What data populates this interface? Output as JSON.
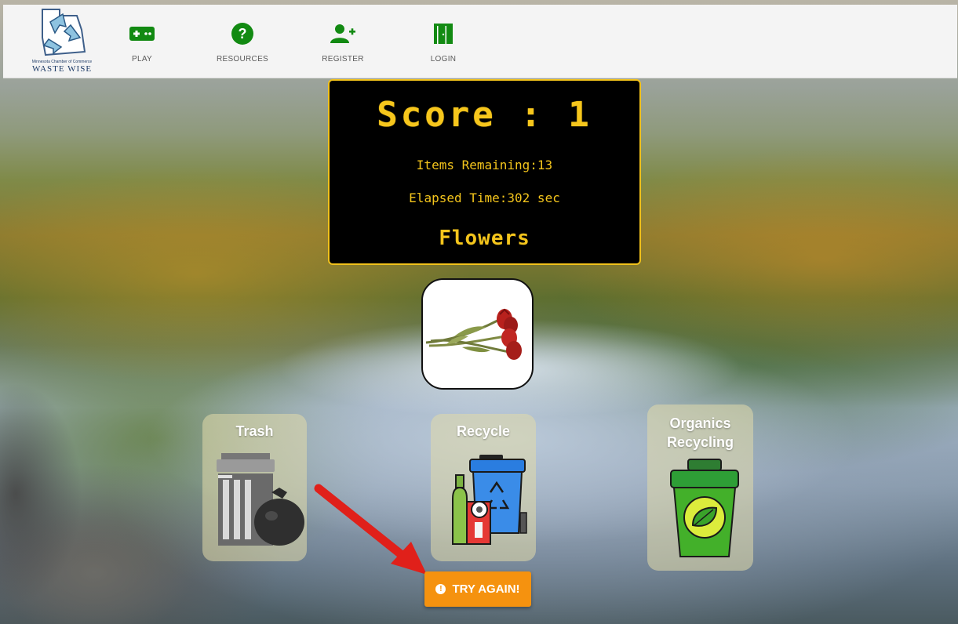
{
  "header": {
    "logo": {
      "subtitle": "Minnesota Chamber of Commerce",
      "title": "WASTE    WISE"
    },
    "nav": [
      {
        "label": "PLAY",
        "icon": "gamepad-icon"
      },
      {
        "label": "RESOURCES",
        "icon": "help-circle-icon"
      },
      {
        "label": "REGISTER",
        "icon": "add-user-icon"
      },
      {
        "label": "LOGIN",
        "icon": "door-icon"
      }
    ],
    "accent_color": "#128a12"
  },
  "scoreboard": {
    "score_label": "Score : 1",
    "items_remaining": "Items Remaining:13",
    "elapsed_time": "Elapsed Time:302 sec",
    "current_item": "Flowers",
    "text_color": "#f4c51c"
  },
  "current_item_image": "flowers-image",
  "bins": [
    {
      "title": "Trash",
      "icon": "trash-can-icon"
    },
    {
      "title": "Recycle",
      "icon": "recycle-bin-icon"
    },
    {
      "title_line1": "Organics",
      "title_line2": "Recycling",
      "icon": "organics-bin-icon"
    }
  ],
  "feedback": {
    "button_label": "TRY AGAIN!",
    "icon": "alert-icon",
    "color": "#f5920f"
  }
}
